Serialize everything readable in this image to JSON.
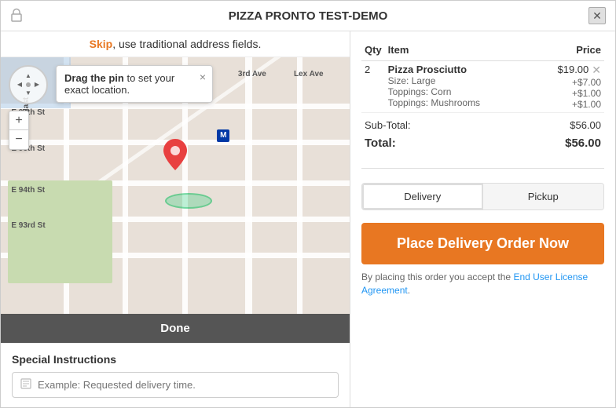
{
  "window": {
    "title": "PIZZA PRONTO TEST-DEMO"
  },
  "skip_bar": {
    "skip_label": "Skip",
    "skip_text": ", use traditional address fields."
  },
  "map": {
    "tooltip_text_bold": "Drag the pin",
    "tooltip_text": " to set your exact location.",
    "tooltip_close": "×",
    "done_label": "Done"
  },
  "special_instructions": {
    "heading": "Special Instructions",
    "placeholder": "Example: Requested delivery time."
  },
  "order": {
    "col_qty": "Qty",
    "col_item": "Item",
    "col_price": "Price",
    "items": [
      {
        "qty": "2",
        "name": "Pizza Prosciutto",
        "price": "$19.00",
        "details": [
          {
            "label": "Size: Large",
            "price": "+$7.00"
          },
          {
            "label": "Toppings: Corn",
            "price": "+$1.00"
          },
          {
            "label": "Toppings: Mushrooms",
            "price": "+$1.00"
          }
        ]
      }
    ],
    "subtotal_label": "Sub-Total:",
    "subtotal_value": "$56.00",
    "total_label": "Total:",
    "total_value": "$56.00"
  },
  "delivery_toggle": {
    "delivery_label": "Delivery",
    "pickup_label": "Pickup"
  },
  "cta": {
    "button_label": "Place Delivery Order Now"
  },
  "eula": {
    "text_before": "By placing this order you accept the ",
    "link_text": "End User License Agreement",
    "text_after": "."
  }
}
